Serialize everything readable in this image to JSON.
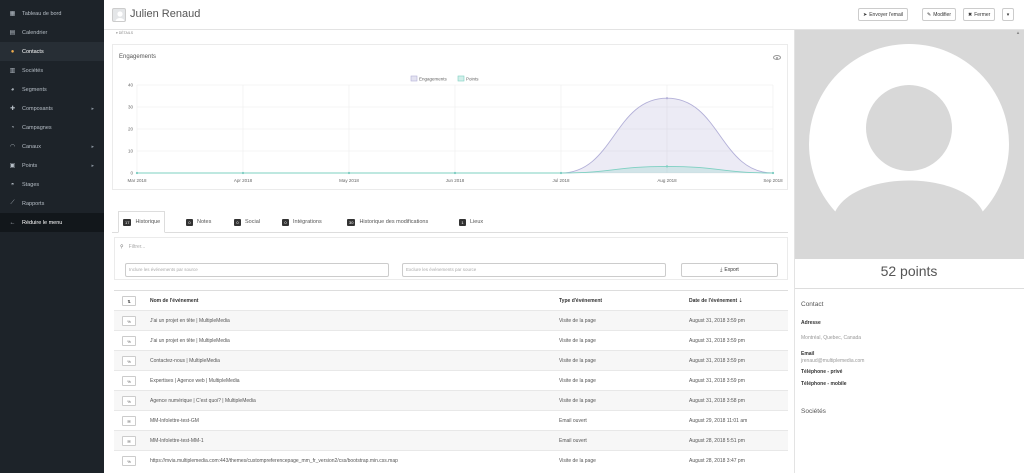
{
  "sidebar": {
    "items": [
      {
        "label": "Tableau de bord",
        "icon": "dashboard-icon",
        "glyph": "▦"
      },
      {
        "label": "Calendrier",
        "icon": "calendar-icon",
        "glyph": "▤"
      },
      {
        "label": "Contacts",
        "icon": "user-icon",
        "glyph": "●"
      },
      {
        "label": "Sociétés",
        "icon": "building-icon",
        "glyph": "▥"
      },
      {
        "label": "Segments",
        "icon": "pie-icon",
        "glyph": "◕"
      },
      {
        "label": "Composants",
        "icon": "puzzle-icon",
        "glyph": "✚"
      },
      {
        "label": "Campagnes",
        "icon": "clock-icon",
        "glyph": "◔"
      },
      {
        "label": "Canaux",
        "icon": "rss-icon",
        "glyph": "◠"
      },
      {
        "label": "Points",
        "icon": "calculator-icon",
        "glyph": "▣"
      },
      {
        "label": "Stages",
        "icon": "tachometer-icon",
        "glyph": "◓"
      },
      {
        "label": "Rapports",
        "icon": "line-chart-icon",
        "glyph": "⟋"
      },
      {
        "label": "Réduire le menu",
        "icon": "arrow-left-icon",
        "glyph": "←"
      }
    ]
  },
  "header": {
    "title": "Julien Renaud",
    "send_email": "Envoyer l'email",
    "edit": "Modifier",
    "close": "Fermer",
    "details_toggle": "▾ DÉTAILS"
  },
  "engagements": {
    "title": "Engagements"
  },
  "chart_data": {
    "type": "area",
    "title": "Engagements",
    "x": [
      "Mar 2018",
      "Apr 2018",
      "May 2018",
      "Jun 2018",
      "Jul 2018",
      "Aug 2018",
      "Sep 2018"
    ],
    "ylim": [
      0,
      40
    ],
    "yticks": [
      0,
      10,
      20,
      30,
      40
    ],
    "series": [
      {
        "name": "Engagements",
        "values": [
          0,
          0,
          0,
          0,
          0,
          34,
          0
        ],
        "color": "#b3b0d8"
      },
      {
        "name": "Points",
        "values": [
          0,
          0,
          0,
          0,
          0,
          3,
          0
        ],
        "color": "#7ed0c2"
      }
    ],
    "legend": "top-center",
    "grid": true
  },
  "tabs": [
    {
      "badge": "17",
      "label": "Historique"
    },
    {
      "badge": "0",
      "label": "Notes"
    },
    {
      "badge": "0",
      "label": "Social"
    },
    {
      "badge": "0",
      "label": "Intégrations"
    },
    {
      "badge": "30",
      "label": "Historique des modifications"
    },
    {
      "badge": "1",
      "label": "Lieux"
    }
  ],
  "filters": {
    "search_placeholder": "Filtrer...",
    "include_placeholder": "Inclure les événements par source",
    "exclude_placeholder": "Exclure les événements par source",
    "export": "Export"
  },
  "table": {
    "headers": [
      "Nom de l'événement",
      "Type d'événement",
      "Date de l'événement"
    ],
    "rows": [
      {
        "icon": "%",
        "name": "J'ai un projet en tête | MultipleMedia",
        "type": "Visite de la page",
        "date": "August 31, 2018 3:59 pm"
      },
      {
        "icon": "%",
        "name": "J'ai un projet en tête | MultipleMedia",
        "type": "Visite de la page",
        "date": "August 31, 2018 3:59 pm"
      },
      {
        "icon": "%",
        "name": "Contactez-nous | MultipleMedia",
        "type": "Visite de la page",
        "date": "August 31, 2018 3:59 pm"
      },
      {
        "icon": "%",
        "name": "Expertises | Agence web | MultipleMedia",
        "type": "Visite de la page",
        "date": "August 31, 2018 3:59 pm"
      },
      {
        "icon": "%",
        "name": "Agence numérique | C'est quoi? | MultipleMedia",
        "type": "Visite de la page",
        "date": "August 31, 2018 3:58 pm"
      },
      {
        "icon": "✉",
        "name": "MM-Infolettre-test-GM",
        "type": "Email ouvert",
        "date": "August 29, 2018 11:01 am"
      },
      {
        "icon": "✉",
        "name": "MM-Infolettre-test-MM-1",
        "type": "Email ouvert",
        "date": "August 28, 2018 5:51 pm"
      },
      {
        "icon": "%",
        "name": "https://mvia.multiplemedia.com:443/themes/custompreferencepage_mm_fr_version2/css/bootstrap.min.css.map",
        "type": "Visite de la page",
        "date": "August 28, 2018 3:47 pm"
      }
    ]
  },
  "profile": {
    "points": "52 points",
    "contact_title": "Contact",
    "address_label": "Adresse",
    "address_value": "Montréal, Quebec, Canada",
    "email_label": "Email",
    "email_value": "jrenaud@multiplemedia.com",
    "phone_private_label": "Téléphone - privé",
    "phone_mobile_label": "Téléphone - mobile",
    "companies_title": "Sociétés"
  }
}
